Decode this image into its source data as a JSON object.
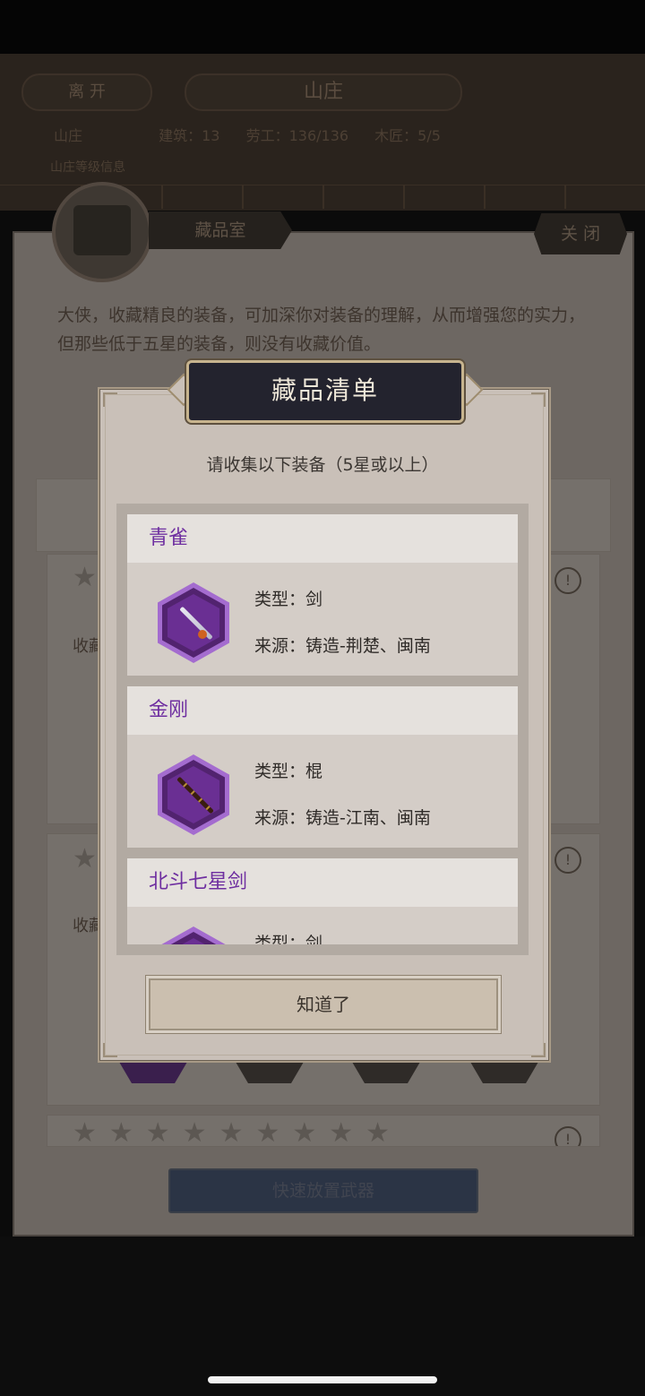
{
  "background": {
    "header": {
      "leave_label": "离 开",
      "title": "山庄",
      "stats_left": "山庄",
      "stats_buildings": "建筑：13",
      "stats_workers": "劳工：136/136",
      "stats_carpenters": "木匠：5/5",
      "sub_text": "山庄等级信息"
    },
    "room": {
      "tab_label": "藏品室",
      "close_label": "关 闭",
      "description": "大侠，收藏精良的装备，可加深你对装备的理解，从而增强您的实力，但那些低于五星的装备，则没有收藏价值。",
      "card_label_1": "收藏",
      "card_label_2": "收藏",
      "info_glyph": "!",
      "stars": "★★★★★★★★★",
      "quick_place_label": "快速放置武器"
    }
  },
  "modal": {
    "title": "藏品清单",
    "subtitle": "请收集以下装备（5星或以上）",
    "items": [
      {
        "name": "青雀",
        "type_line": "类型：剑",
        "source_line": "来源：铸造-荆楚、闽南",
        "icon": "sword-icon"
      },
      {
        "name": "金刚",
        "type_line": "类型：棍",
        "source_line": "来源：铸造-江南、闽南",
        "icon": "staff-icon"
      },
      {
        "name": "北斗七星剑",
        "type_line": "类型：剑",
        "source_line": "",
        "icon": "sword-icon"
      }
    ],
    "ok_label": "知道了"
  },
  "colors": {
    "item_name": "#6e2ea0",
    "hex_frame": "#a46ccf",
    "title_plate": "#23232e",
    "quick_button": "#2b3445"
  }
}
